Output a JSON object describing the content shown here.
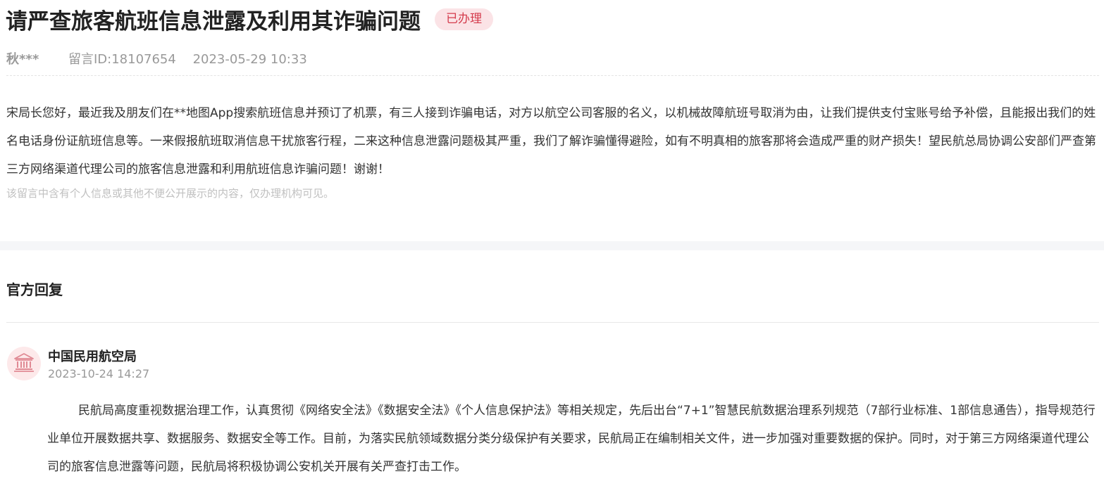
{
  "message": {
    "title": "请严查旅客航班信息泄露及利用其诈骗问题",
    "status": "已办理",
    "author": "秋***",
    "id_text": "留言ID:18107654",
    "time": "2023-05-29 10:33",
    "content": "宋局长您好，最近我及朋友们在**地图App搜索航班信息并预订了机票，有三人接到诈骗电话，对方以航空公司客服的名义，以机械故障航班号取消为由，让我们提供支付宝账号给予补偿，且能报出我们的姓名电话身份证航班信息等。一来假报航班取消信息干扰旅客行程，二来这种信息泄露问题极其严重，我们了解诈骗懂得避险，如有不明真相的旅客那将会造成严重的财产损失！望民航总局协调公安部们严查第三方网络渠道代理公司的旅客信息泄露和利用航班信息诈骗问题！谢谢！",
    "privacy_note": "该留言中含有个人信息或其他不便公开展示的内容，仅办理机构可见。"
  },
  "reply": {
    "heading": "官方回复",
    "avatar_icon": "government-building-icon",
    "org_name": "中国民用航空局",
    "time": "2023-10-24 14:27",
    "content": "民航局高度重视数据治理工作，认真贯彻《网络安全法》《数据安全法》《个人信息保护法》等相关规定，先后出台“7+1”智慧民航数据治理系列规范（7部行业标准、1部信息通告），指导规范行业单位开展数据共享、数据服务、数据安全等工作。目前，为落实民航领域数据分类分级保护有关要求，民航局正在编制相关文件，进一步加强对重要数据的保护。同时，对于第三方网络渠道代理公司的旅客信息泄露等问题，民航局将积极协调公安机关开展有关严查打击工作。"
  },
  "colors": {
    "accent": "#d43b4c",
    "badge_bg": "#fbe3e6",
    "avatar_bg": "#fde9ea",
    "muted": "#999999",
    "band": "#f5f6f8"
  }
}
